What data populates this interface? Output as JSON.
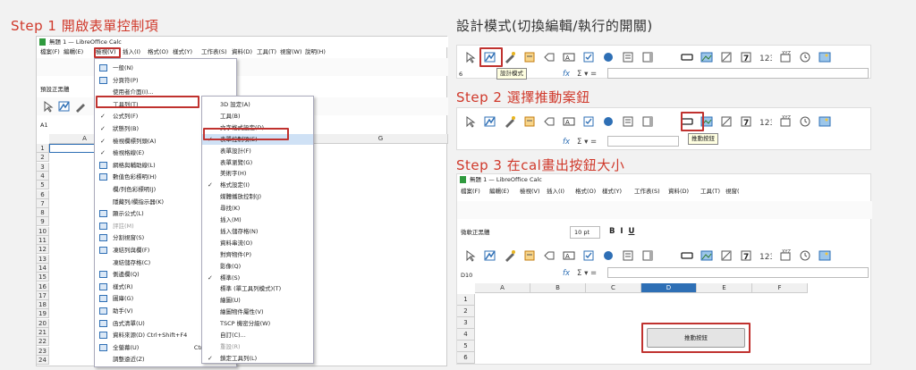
{
  "step1": {
    "heading": "Step 1 開啟表單控制項",
    "window_title": "無題 1 — LibreOffice Calc",
    "menubar": [
      "檔案(F)",
      "編輯(E)",
      "檢視(V)",
      "插入(I)",
      "格式(O)",
      "樣式(Y)",
      "工作表(S)",
      "資料(D)",
      "工具(T)",
      "視窗(W)",
      "說明(H)"
    ],
    "style_box": "預設正黑體",
    "cell_ref": "A1",
    "col_a": "A",
    "col_g": "G",
    "rows": [
      "1",
      "2",
      "3",
      "4",
      "5",
      "6",
      "7",
      "8",
      "9",
      "10",
      "11",
      "12",
      "13",
      "14",
      "15",
      "16",
      "17",
      "18",
      "19",
      "20",
      "21",
      "22",
      "23",
      "24"
    ],
    "view_menu": [
      {
        "label": "一般(N)",
        "key": ""
      },
      {
        "label": "分頁符(P)",
        "key": ""
      },
      {
        "label": "使用者介面(I)...",
        "key": ""
      },
      {
        "label": "工具列(T)",
        "key": ""
      },
      {
        "label": "公式列(F)",
        "key": ""
      },
      {
        "label": "狀態列(B)",
        "key": ""
      },
      {
        "label": "檢視欄標列頭(A)",
        "key": ""
      },
      {
        "label": "檢視格線(E)",
        "key": ""
      },
      {
        "label": "網格與輔助線(L)",
        "key": ""
      },
      {
        "label": "數值色彩標明(H)",
        "key": "Ctrl+F8"
      },
      {
        "label": "欄/列色彩標明(J)",
        "key": ""
      },
      {
        "label": "隱藏列/欄指示器(K)",
        "key": ""
      },
      {
        "label": "顯示公式(L)",
        "key": "Ctrl+`"
      },
      {
        "label": "評註(M)",
        "key": ""
      },
      {
        "label": "分割視窗(S)",
        "key": ""
      },
      {
        "label": "凍結列與欄(F)",
        "key": ""
      },
      {
        "label": "凍結儲存格(C)",
        "key": ""
      },
      {
        "label": "側邊欄(Q)",
        "key": "Ctrl+F5"
      },
      {
        "label": "樣式(R)",
        "key": "F11"
      },
      {
        "label": "圖庫(G)",
        "key": ""
      },
      {
        "label": "助手(V)",
        "key": "F5"
      },
      {
        "label": "函式清單(U)",
        "key": ""
      },
      {
        "label": "資料來源(D) Ctrl+Shift+F4",
        "key": ""
      },
      {
        "label": "全螢幕(U)",
        "key": "Ctrl+Shift+J"
      },
      {
        "label": "調整遠近(Z)",
        "key": ""
      }
    ],
    "toolbar_menu": [
      "3D 設定(A)",
      "工具(B)",
      "文字格式設定(D)",
      "表單控制項(E)",
      "表單設計(F)",
      "表單瀏覽(G)",
      "美術字(H)",
      "格式設定(I)",
      "媒體播放控制(J)",
      "尋找(K)",
      "插入(M)",
      "插入儲存格(N)",
      "資料串流(O)",
      "對齊物件(P)",
      "影像(Q)",
      "標準(S)",
      "標準 (單工具列模式)(T)",
      "繪圖(U)",
      "繪圖物件屬性(V)",
      "TSCP 機密分級(W)",
      "自訂(C)...",
      "重設(R)",
      "鎖定工具列(L)"
    ]
  },
  "design": {
    "heading": "設計模式(切換編輯/執行的開關)",
    "tooltip": "設計模式",
    "cell_ref": "6",
    "fx": "fx"
  },
  "step2": {
    "heading": "Step 2 選擇推動案鈕",
    "tooltip": "推動按鈕",
    "fx": "fx"
  },
  "step3": {
    "heading": "Step 3 在cal畫出按鈕大小",
    "window_title": "無題 1 — LibreOffice Calc",
    "menubar": [
      "檔案(F)",
      "編輯(E)",
      "檢視(V)",
      "插入(I)",
      "格式(O)",
      "樣式(Y)",
      "工作表(S)",
      "資料(D)",
      "工具(T)",
      "視窗("
    ],
    "style_box": "微軟正黑體",
    "font_size": "10 pt",
    "cell_ref": "D10",
    "columns": [
      "A",
      "B",
      "C",
      "D",
      "E",
      "F"
    ],
    "rows": [
      "1",
      "2",
      "3",
      "4",
      "5",
      "6"
    ],
    "button_label": "推動按鈕",
    "fx": "fx"
  },
  "colors": {
    "accent_red": "#c0322f",
    "heading_red": "#d0392b",
    "highlight_blue": "#cfe1f5"
  }
}
